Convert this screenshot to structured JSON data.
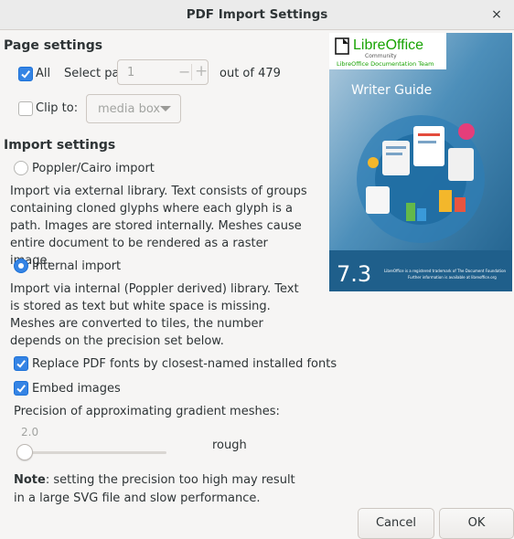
{
  "window": {
    "title": "PDF Import Settings",
    "close_glyph": "×"
  },
  "page_settings": {
    "heading": "Page settings",
    "all_label": "All",
    "all_checked": true,
    "select_page_label": "Select page:",
    "page_value": "1",
    "spin_minus": "−",
    "spin_plus": "+",
    "out_of_label": "out of 479",
    "clip_to_label": "Clip to:",
    "clip_to_checked": false,
    "clip_value": "media box"
  },
  "import_settings": {
    "heading": "Import settings",
    "poppler_label": "Poppler/Cairo import",
    "poppler_selected": false,
    "poppler_desc": "Import via external library. Text consists of groups containing cloned glyphs where each glyph is a path. Images are stored internally. Meshes cause entire document to be rendered as a raster image.",
    "internal_label": "Internal import",
    "internal_selected": true,
    "internal_desc": "Import via internal (Poppler derived) library. Text is stored as text but white space is missing. Meshes are converted to tiles, the number depends on the precision set below.",
    "replace_fonts_label": "Replace PDF fonts by closest-named installed fonts",
    "replace_fonts_checked": true,
    "embed_images_label": "Embed images",
    "embed_images_checked": true,
    "precision_label": "Precision of approximating gradient meshes:",
    "precision_value": "2.0",
    "precision_fraction": 0.0,
    "precision_word": "rough",
    "note_bold": "Note",
    "note_text": ": setting the precision too high may result in a large SVG file and slow performance."
  },
  "preview": {
    "logo_text": "LibreOffice",
    "logo_sub": "Community",
    "team": "LibreOffice Documentation Team",
    "book_title": "Writer Guide",
    "version": "7.3",
    "footer_line1": "LibreOffice is a registered trademark of The Document Foundation",
    "footer_line2": "Further information is available at libreoffice.org"
  },
  "buttons": {
    "cancel": "Cancel",
    "ok": "OK"
  },
  "colors": {
    "accent": "#3584e4",
    "libreoffice_green": "#18a303",
    "cover_blue": "#2d6f9e"
  }
}
